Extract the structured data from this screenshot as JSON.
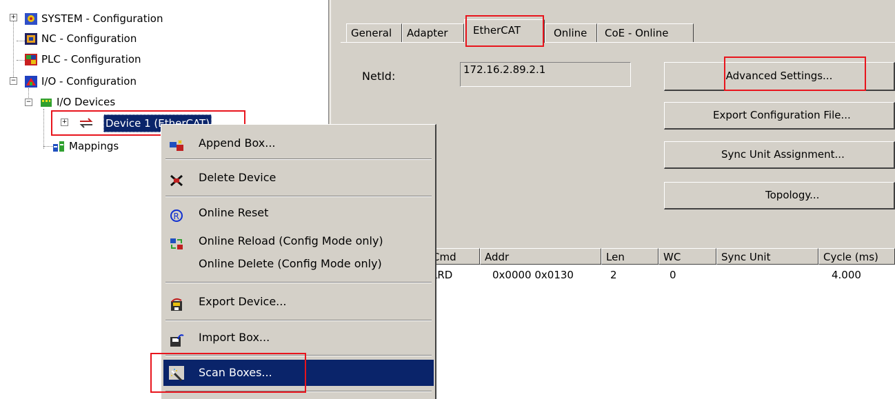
{
  "tree": {
    "system": "SYSTEM - Configuration",
    "nc": "NC - Configuration",
    "plc": "PLC - Configuration",
    "io": "I/O - Configuration",
    "io_devices": "I/O Devices",
    "device1": "Device 1 (EtherCAT)",
    "mappings": "Mappings"
  },
  "tabs": [
    "General",
    "Adapter",
    "EtherCAT",
    "Online",
    "CoE - Online"
  ],
  "netid_label": "NetId:",
  "netid_value": "172.16.2.89.2.1",
  "buttons": {
    "advanced": "Advanced Settings...",
    "export_config": "Export Configuration File...",
    "sync_unit": "Sync Unit Assignment...",
    "topology": "Topology..."
  },
  "columns": [
    "Cmd",
    "Addr",
    "Len",
    "WC",
    "Sync Unit",
    "Cycle (ms)"
  ],
  "rows": [
    {
      "cmd": "LRD",
      "addr": "0x0000 0x0130",
      "len": "2",
      "wc": "0",
      "sync": "",
      "cycle": "4.000"
    }
  ],
  "menu": {
    "append_box": "Append Box...",
    "delete_device": "Delete Device",
    "online_reset": "Online Reset",
    "online_reload": "Online Reload (Config Mode only)",
    "online_delete": "Online Delete (Config Mode only)",
    "export_device": "Export Device...",
    "import_box": "Import Box...",
    "scan_boxes": "Scan Boxes..."
  },
  "colors": {
    "highlight": "#0a246a",
    "annotation": "#e8141c",
    "face": "#d4d0c8"
  }
}
